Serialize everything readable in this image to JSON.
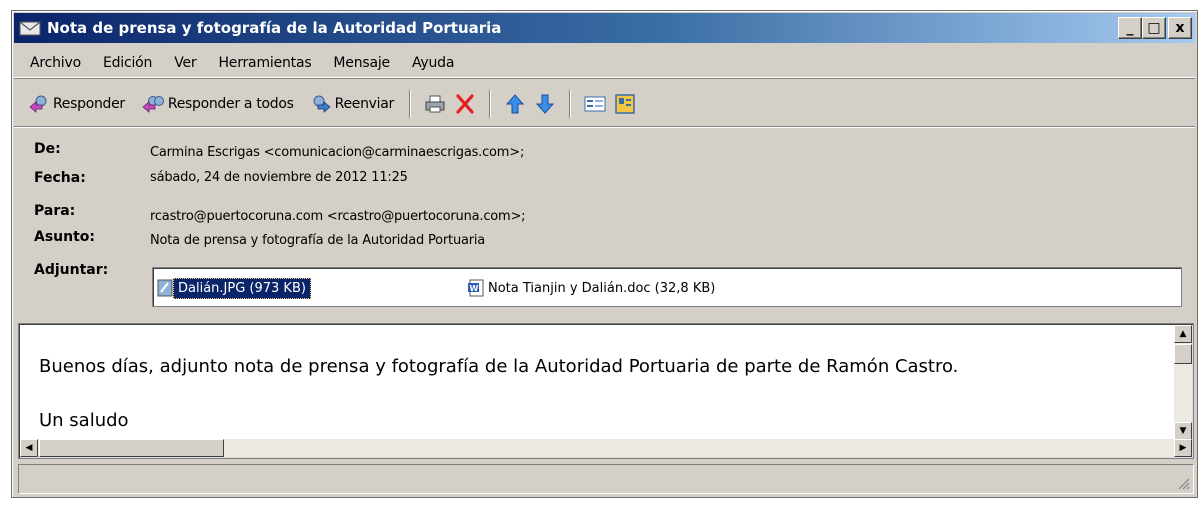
{
  "window": {
    "title": "Nota de prensa y fotografía de la Autoridad Portuaria",
    "controls": {
      "minimize": "_",
      "maximize": "□",
      "close": "x"
    }
  },
  "menu": [
    "Archivo",
    "Edición",
    "Ver",
    "Herramientas",
    "Mensaje",
    "Ayuda"
  ],
  "toolbar": {
    "reply": "Responder",
    "reply_all": "Responder a todos",
    "forward": "Reenviar"
  },
  "headers": {
    "from_label": "De:",
    "from_value": "Carmina Escrigas <comunicacion@carminaescrigas.com>;",
    "date_label": "Fecha:",
    "date_value": "sábado, 24 de noviembre de 2012 11:25",
    "to_label": "Para:",
    "to_value": "rcastro@puertocoruna.com <rcastro@puertocoruna.com>;",
    "subject_label": "Asunto:",
    "subject_value": "Nota de prensa y fotografía de la Autoridad Portuaria",
    "attach_label": "Adjuntar:"
  },
  "attachments": [
    {
      "name": "Dalián.JPG (973 KB)",
      "icon": "image-file-icon",
      "selected": true
    },
    {
      "name": "Nota Tianjin y Dalián.doc (32,8 KB)",
      "icon": "word-document-icon",
      "selected": false
    }
  ],
  "body": {
    "line1": "Buenos días, adjunto nota de prensa y fotografía de la Autoridad Portuaria de parte de Ramón Castro.",
    "line2": "Un saludo"
  },
  "colors": {
    "titlebar_start": "#0a246a",
    "titlebar_end": "#a6caf0",
    "chrome": "#d4d0c8",
    "selection": "#0a246a"
  }
}
